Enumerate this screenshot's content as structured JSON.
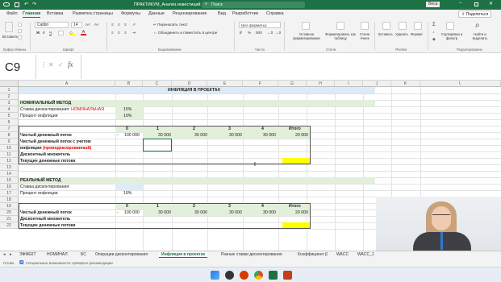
{
  "app": {
    "title": "ПРАКТИКУМ_Анализ инвестиций - Excel",
    "search_placeholder": "Поиск",
    "user": "Веса",
    "share": "Поделиться"
  },
  "tabs": [
    "Файл",
    "Главная",
    "Вставка",
    "Разметка страницы",
    "Формулы",
    "Данные",
    "Рецензирование",
    "Вид",
    "Разработчик",
    "Справка"
  ],
  "ribbon": {
    "paste": "Вставить",
    "font_name": "Calibri",
    "font_size": "14",
    "wrap": "Переносить текст",
    "merge": "Объединить и поместить в центре",
    "number_format": "(все форматы)",
    "cond_format": "Условное форматирование",
    "format_table": "Форматировать как таблицу",
    "cell_styles": "Стили ячеек",
    "insert": "Вставить",
    "delete": "Удалить",
    "format": "Формат",
    "sort": "Сортировка и фильтр",
    "find": "Найти и выделить",
    "groups": [
      "Буфер обмена",
      "Шрифт",
      "Выравнивание",
      "Число",
      "Стили",
      "Ячейки",
      "Редактирование"
    ]
  },
  "namebox": "C9",
  "formula_value": "",
  "columns": [
    "A",
    "B",
    "C",
    "D",
    "E",
    "F",
    "G",
    "H",
    "I",
    "J",
    "K",
    "L"
  ],
  "rows": [
    "1",
    "2",
    "3",
    "4",
    "5",
    "6",
    "7",
    "8",
    "9",
    "10",
    "11",
    "12",
    "13",
    "14",
    "15",
    "16",
    "17",
    "18",
    "19",
    "20",
    "21",
    "22"
  ],
  "sheet": {
    "title": "ИНФЛЯЦИЯ В ПРОЕКТАХ",
    "nominal": {
      "header": "НОМИНАЛЬНЫЙ МЕТОД",
      "rate_label": "Ставка дисконтирования: ",
      "rate_label_red": "НОМИНАЛЬНАЯ",
      "rate_value": "15%",
      "inflation_label": "Процент инфляции",
      "inflation_value": "10%",
      "periods": [
        "0",
        "1",
        "2",
        "3",
        "4"
      ],
      "total_label": "Итого",
      "cf_label": "Чистый денежный поток",
      "cf_values": [
        "-",
        "100 000",
        "30 000",
        "30 000",
        "30 000",
        "30 000"
      ],
      "cf_total": "20 000",
      "cf_infl_label": "Чистый денежный поток с учетом",
      "cf_infl_label2": "инфляции ",
      "cf_infl_label2_red": "(проиндексированный)",
      "dm_label": "Дисконтный множитель",
      "pv_label": "Текущие денежные потоки"
    },
    "real": {
      "header": "РЕАЛЬНЫЙ МЕТОД",
      "rate_label": "Ставка дисконтирования:",
      "inflation_label": "Процент инфляции",
      "inflation_value": "10%",
      "periods": [
        "0",
        "1",
        "2",
        "3",
        "4"
      ],
      "total_label": "Итого",
      "cf_label": "Чистый денежный поток",
      "cf_values": [
        "-",
        "100 000",
        "30 000",
        "30 000",
        "30 000",
        "30 000"
      ],
      "cf_total": "20 000",
      "dm_label": "Дисконтный множитель",
      "pv_label": "Текущие денежные потоки"
    }
  },
  "sheet_tabs": [
    "ЭФФЕКТ",
    "НОМИНАЛ",
    "БС",
    "Операции дисконтирования",
    "Инфляция в проектах",
    "Разные ставки дисконтирования",
    "Коэффициент β",
    "WACC",
    "WACC_1"
  ],
  "active_sheet": "Инфляция в проектах",
  "status": {
    "ready": "Готово",
    "accessibility": "Специальные возможности: проверьте рекомендации"
  },
  "colors": {
    "accent": "#1e7145",
    "section_fill": "#e2efda",
    "input_fill": "#ddebf7",
    "yellow": "#ffff00",
    "red": "#e00000"
  }
}
